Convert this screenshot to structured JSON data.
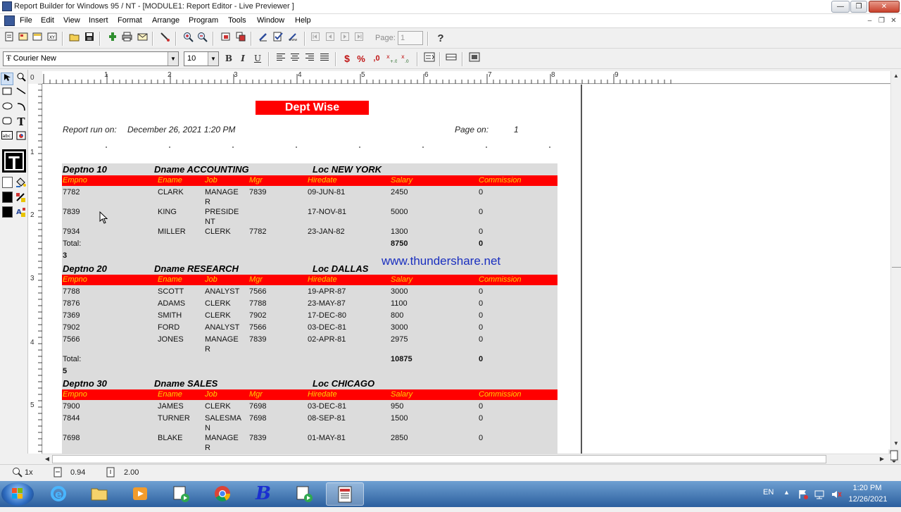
{
  "window": {
    "title": "Report Builder for Windows 95 / NT - [MODULE1: Report Editor - Live Previewer ]",
    "minimize": "—",
    "maximize": "❐",
    "close": "✕"
  },
  "menu": {
    "items": [
      "File",
      "Edit",
      "View",
      "Insert",
      "Format",
      "Arrange",
      "Program",
      "Tools",
      "Window",
      "Help"
    ],
    "mdi_minimize": "–",
    "mdi_restore": "❐",
    "mdi_close": "✕"
  },
  "toolbar": {
    "page_label": "Page:",
    "page_value": "1",
    "help_glyph": "?"
  },
  "format_toolbar": {
    "font": "Courier New",
    "font_glyph": "Ŧ",
    "size": "10",
    "bold": "B",
    "italic": "I",
    "underline": "U",
    "currency": "$",
    "percent": "%",
    "comma": ",0"
  },
  "palette": {
    "text_tool": "T",
    "big_text": "T"
  },
  "ruler": {
    "h_marks": [
      "1",
      "2",
      "3",
      "4",
      "5",
      "6",
      "7",
      "8",
      "9"
    ],
    "v_marks": [
      "0",
      "1",
      "2",
      "3",
      "4",
      "5"
    ]
  },
  "report": {
    "title": "Dept Wise",
    "run_on_label": "Report run on:",
    "run_on_value": "December 26, 2021 1:20 PM",
    "page_label": "Page on:",
    "page_value": "1",
    "columns": [
      "Empno",
      "Ename",
      "Job",
      "Mgr",
      "Hiredate",
      "Salary",
      "Commission"
    ],
    "groups": [
      {
        "deptno": "Deptno 10",
        "dname": "Dname ACCOUNTING",
        "loc": "Loc NEW YORK",
        "rows": [
          {
            "empno": "7782",
            "ename": "CLARK",
            "job1": "MANAGE",
            "job2": "R",
            "mgr": "7839",
            "hiredate": "09-JUN-81",
            "salary": "2450",
            "comm": "0"
          },
          {
            "empno": "7839",
            "ename": "KING",
            "job1": "PRESIDE",
            "job2": "NT",
            "mgr": "",
            "hiredate": "17-NOV-81",
            "salary": "5000",
            "comm": "0"
          },
          {
            "empno": "7934",
            "ename": "MILLER",
            "job1": "CLERK",
            "job2": "",
            "mgr": "7782",
            "hiredate": "23-JAN-82",
            "salary": "1300",
            "comm": "0"
          }
        ],
        "total_label": "Total:",
        "total_salary": "8750",
        "total_comm": "0",
        "count": "3"
      },
      {
        "deptno": "Deptno 20",
        "dname": "Dname RESEARCH",
        "loc": "Loc DALLAS",
        "rows": [
          {
            "empno": "7788",
            "ename": "SCOTT",
            "job1": "ANALYST",
            "job2": "",
            "mgr": "7566",
            "hiredate": "19-APR-87",
            "salary": "3000",
            "comm": "0"
          },
          {
            "empno": "7876",
            "ename": "ADAMS",
            "job1": "CLERK",
            "job2": "",
            "mgr": "7788",
            "hiredate": "23-MAY-87",
            "salary": "1100",
            "comm": "0"
          },
          {
            "empno": "7369",
            "ename": "SMITH",
            "job1": "CLERK",
            "job2": "",
            "mgr": "7902",
            "hiredate": "17-DEC-80",
            "salary": "800",
            "comm": "0"
          },
          {
            "empno": "7902",
            "ename": "FORD",
            "job1": "ANALYST",
            "job2": "",
            "mgr": "7566",
            "hiredate": "03-DEC-81",
            "salary": "3000",
            "comm": "0"
          },
          {
            "empno": "7566",
            "ename": "JONES",
            "job1": "MANAGE",
            "job2": "R",
            "mgr": "7839",
            "hiredate": "02-APR-81",
            "salary": "2975",
            "comm": "0"
          }
        ],
        "total_label": "Total:",
        "total_salary": "10875",
        "total_comm": "0",
        "count": "5"
      },
      {
        "deptno": "Deptno 30",
        "dname": "Dname SALES",
        "loc": "Loc CHICAGO",
        "rows": [
          {
            "empno": "7900",
            "ename": "JAMES",
            "job1": "CLERK",
            "job2": "",
            "mgr": "7698",
            "hiredate": "03-DEC-81",
            "salary": "950",
            "comm": "0"
          },
          {
            "empno": "7844",
            "ename": "TURNER",
            "job1": "SALESMA",
            "job2": "N",
            "mgr": "7698",
            "hiredate": "08-SEP-81",
            "salary": "1500",
            "comm": "0"
          },
          {
            "empno": "7698",
            "ename": "BLAKE",
            "job1": "MANAGE",
            "job2": "R",
            "mgr": "7839",
            "hiredate": "01-MAY-81",
            "salary": "2850",
            "comm": "0"
          }
        ]
      }
    ],
    "watermark": "www.thundershare.net"
  },
  "status": {
    "zoom": "1x",
    "x": "0.94",
    "y": "2.00"
  },
  "taskbar": {
    "lang": "EN",
    "time": "1:20 PM",
    "date": "12/26/2021",
    "b_label": "B"
  },
  "colors": {
    "report_red": "#ff0000",
    "header_text": "#ffd000",
    "body_gray": "#dcdcdc",
    "watermark": "#1a2fbf"
  }
}
